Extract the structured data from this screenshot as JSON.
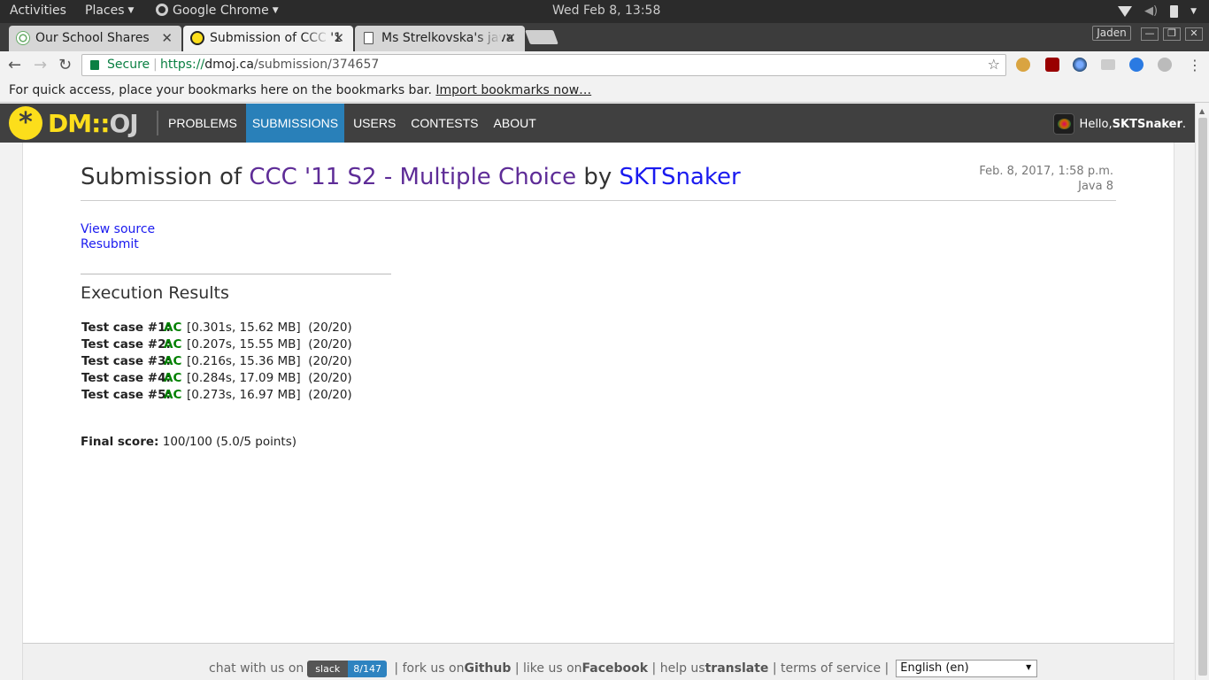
{
  "os_bar": {
    "activities": "Activities",
    "places": "Places",
    "app": "Google Chrome",
    "clock": "Wed Feb  8, 13:58"
  },
  "tabs": [
    {
      "title": "Our School Shares",
      "active": false
    },
    {
      "title": "Submission of CCC '1",
      "active": true
    },
    {
      "title": "Ms Strelkovska's java",
      "active": false
    }
  ],
  "profile_name": "Jaden",
  "omnibox": {
    "secure_label": "Secure",
    "scheme": "https://",
    "host": "dmoj.ca",
    "path": "/submission/374657"
  },
  "bookmarks_bar": {
    "message": "For quick access, place your bookmarks here on the bookmarks bar.",
    "import_link": "Import bookmarks now…"
  },
  "site": {
    "logo_mark": "*",
    "logo_dm": "DM::",
    "logo_oj": "OJ",
    "nav": [
      {
        "label": "PROBLEMS",
        "active": false
      },
      {
        "label": "SUBMISSIONS",
        "active": true
      },
      {
        "label": "USERS",
        "active": false
      },
      {
        "label": "CONTESTS",
        "active": false
      },
      {
        "label": "ABOUT",
        "active": false
      }
    ],
    "greeting": "Hello, ",
    "username": "SKTSnaker",
    "greeting_end": "."
  },
  "submission": {
    "title_prefix": "Submission of ",
    "problem": "CCC '11 S2 - Multiple Choice",
    "title_by": " by ",
    "user": "SKTSnaker",
    "date": "Feb. 8, 2017, 1:58 p.m.",
    "language": "Java 8",
    "view_source": "View source",
    "resubmit": "Resubmit",
    "results_heading": "Execution Results",
    "cases": [
      {
        "label": "Test case #1:",
        "status": "AC",
        "detail": "[0.301s, 15.62 MB]",
        "points": "(20/20)"
      },
      {
        "label": "Test case #2:",
        "status": "AC",
        "detail": "[0.207s, 15.55 MB]",
        "points": "(20/20)"
      },
      {
        "label": "Test case #3:",
        "status": "AC",
        "detail": "[0.216s, 15.36 MB]",
        "points": "(20/20)"
      },
      {
        "label": "Test case #4:",
        "status": "AC",
        "detail": "[0.284s, 17.09 MB]",
        "points": "(20/20)"
      },
      {
        "label": "Test case #5:",
        "status": "AC",
        "detail": "[0.273s, 16.97 MB]",
        "points": "(20/20)"
      }
    ],
    "final_label": "Final score:",
    "final_value": "100/100 (5.0/5 points)"
  },
  "footer": {
    "chat": "chat with us on",
    "slack_label": "slack",
    "slack_count": "8/147",
    "fork": "fork us on ",
    "github": "Github",
    "like": "like us on ",
    "facebook": "Facebook",
    "help": "help us ",
    "translate": "translate",
    "terms": "terms of service",
    "language": "English (en)"
  },
  "colors": {
    "nav_bg": "#404040",
    "nav_active": "#2980b9",
    "logo_yellow": "#fcde1b",
    "problem_link": "#5e2c97",
    "user_link": "#1a1aef",
    "ac_green": "#008000"
  }
}
